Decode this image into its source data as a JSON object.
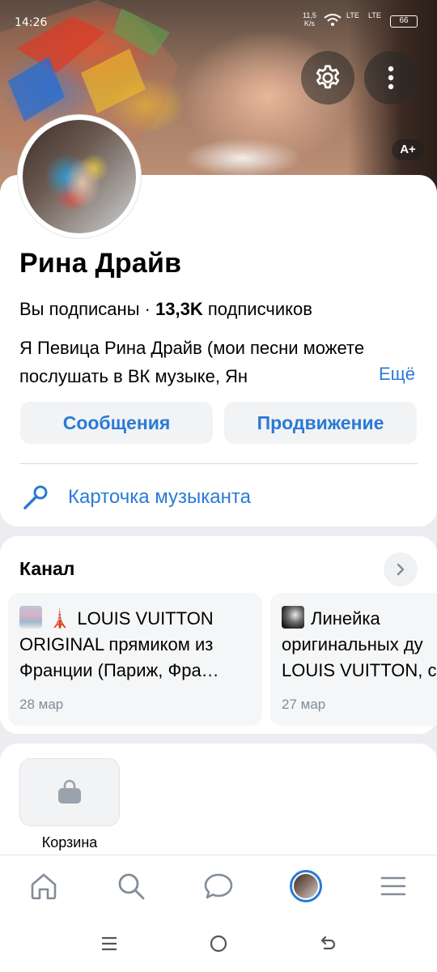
{
  "status_bar": {
    "time": "14:26",
    "net_speed": "11,5",
    "net_unit": "K/s",
    "lte1": "LTE",
    "lte2": "LTE",
    "battery": "66"
  },
  "header": {
    "font_size_label": "A+"
  },
  "profile": {
    "name": "Рина Драйв",
    "subscribed": "Вы подписаны · ",
    "followers_count": "13,3K",
    "followers_label": " подписчиков",
    "about": "Я Певица Рина Драйв  (мои песни можете послушать в ВК музыке, Ян",
    "more_label": "Ещё",
    "messages_label": "Сообщения",
    "promo_label": "Продвижение",
    "music_card_label": "Карточка музыканта"
  },
  "channel": {
    "title": "Канал",
    "posts": [
      {
        "line1": "LOUIS VUITTON",
        "line2": "ORIGINAL прямиком из",
        "line3": "Франции (Париж, Фра…",
        "date": "28 мар"
      },
      {
        "line1": "Линейка",
        "line2": "оригинальных ду",
        "line3": "LOUIS VUITTON, с",
        "date": "27 мар"
      }
    ]
  },
  "shop": {
    "cart_label": "Корзина"
  },
  "colors": {
    "accent": "#2a7ad6",
    "secondary_text": "#818c99",
    "bg": "#ebedf0"
  }
}
